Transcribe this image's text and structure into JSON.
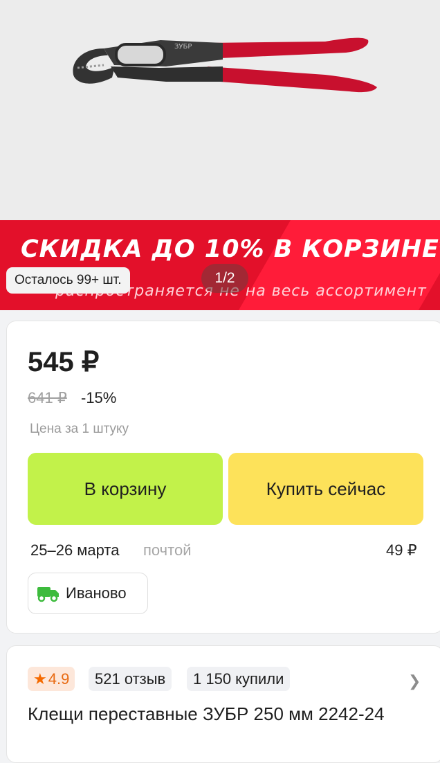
{
  "gallery": {
    "promo_title": "СКИДКА ДО 10% В КОРЗИНЕ*",
    "promo_subtitle": "распространяется не на весь ассортимент",
    "stock_label": "Осталось 99+ шт.",
    "pager_label": "1/2",
    "product_image_icon": "pliers-image",
    "brand_accent": "#e3102a"
  },
  "price": {
    "current": "545 ₽",
    "old": "641 ₽",
    "discount": "-15%",
    "unit_note": "Цена за 1 штуку"
  },
  "actions": {
    "cart_label": "В корзину",
    "cart_color": "#c2f24a",
    "buy_now_label": "Купить сейчас",
    "buy_now_color": "#fde25a"
  },
  "delivery": {
    "date": "25–26 марта",
    "method": "почтой",
    "price": "49 ₽",
    "city": "Иваново",
    "city_icon": "delivery-truck-icon"
  },
  "product": {
    "rating": "4.9",
    "reviews": "521 отзыв",
    "bought": "1 150 купили",
    "title": "Клещи переставные ЗУБР 250 мм 2242-24"
  }
}
